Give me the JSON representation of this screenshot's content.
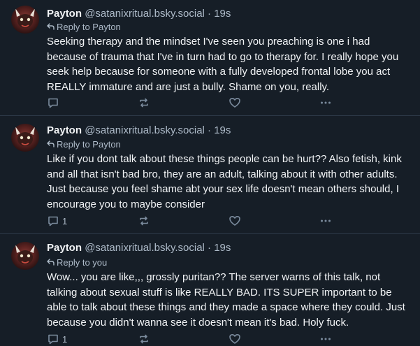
{
  "posts": [
    {
      "name": "Payton",
      "handle": "@satanixritual.bsky.social",
      "separator": "·",
      "time": "19s",
      "reply_to": "Reply to Payton",
      "text": "Seeking therapy and the mindset I've seen you preaching is one i had because of trauma that I've in turn had to go to therapy for. I really hope you seek help because for someone with a fully developed frontal lobe you act REALLY immature and are just a bully. Shame on you, really.",
      "reply_count": ""
    },
    {
      "name": "Payton",
      "handle": "@satanixritual.bsky.social",
      "separator": "·",
      "time": "19s",
      "reply_to": "Reply to Payton",
      "text": "Like if you dont talk about these things people can be hurt?? Also fetish, kink and all that isn't bad bro, they are an adult, talking about it with other adults. Just because you feel shame abt your sex life doesn't mean others should, I encourage you to maybe consider",
      "reply_count": "1"
    },
    {
      "name": "Payton",
      "handle": "@satanixritual.bsky.social",
      "separator": "·",
      "time": "19s",
      "reply_to": "Reply to you",
      "text": "Wow... you are like,,, grossly puritan?? The server warns of this talk, not talking about sexual stuff is like REALLY BAD. ITS SUPER important to be able to talk about these things and they made a space where they could. Just because you didn't wanna see it doesn't mean it's bad. Holy fuck.",
      "reply_count": "1"
    }
  ],
  "icons": {
    "reply": "reply-icon",
    "repost": "repost-icon",
    "like": "heart-icon",
    "more": "more-icon",
    "reply_arrow": "reply-arrow-icon"
  },
  "colors": {
    "background": "#161e27",
    "divider": "#2e3b4a",
    "text": "#f1f3f5",
    "muted": "#aebbc9",
    "icon": "#7b8b9d"
  }
}
